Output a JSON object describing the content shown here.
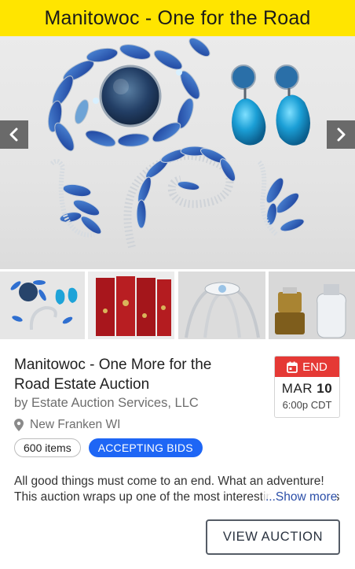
{
  "banner": {
    "title": "Manitowoc - One for the Road"
  },
  "gallery": {
    "prev_icon": "chevron-left-icon",
    "next_icon": "chevron-right-icon",
    "thumbnails": [
      "thumbnail-jewelry",
      "thumbnail-red-screen",
      "thumbnail-crystal-crown",
      "thumbnail-lighters"
    ]
  },
  "auction": {
    "title": "Manitowoc - One More for the Road Estate Auction",
    "company": "by Estate Auction Services, LLC",
    "location": "New Franken WI",
    "items_count": "600 items",
    "status": "ACCEPTING BIDS",
    "description": "All good things must come to an end. What an adventure! This auction wraps up one of the most interesting collections we have had the pleasure to offer.",
    "show_more": "...Show more",
    "view_button": "VIEW AUCTION"
  },
  "end": {
    "label": "END",
    "month": "MAR",
    "day": "10",
    "time": "6:00p CDT"
  },
  "colors": {
    "banner": "#ffe500",
    "end_header": "#e53935",
    "status_pill": "#1e66f5",
    "link": "#2b4ea8"
  }
}
